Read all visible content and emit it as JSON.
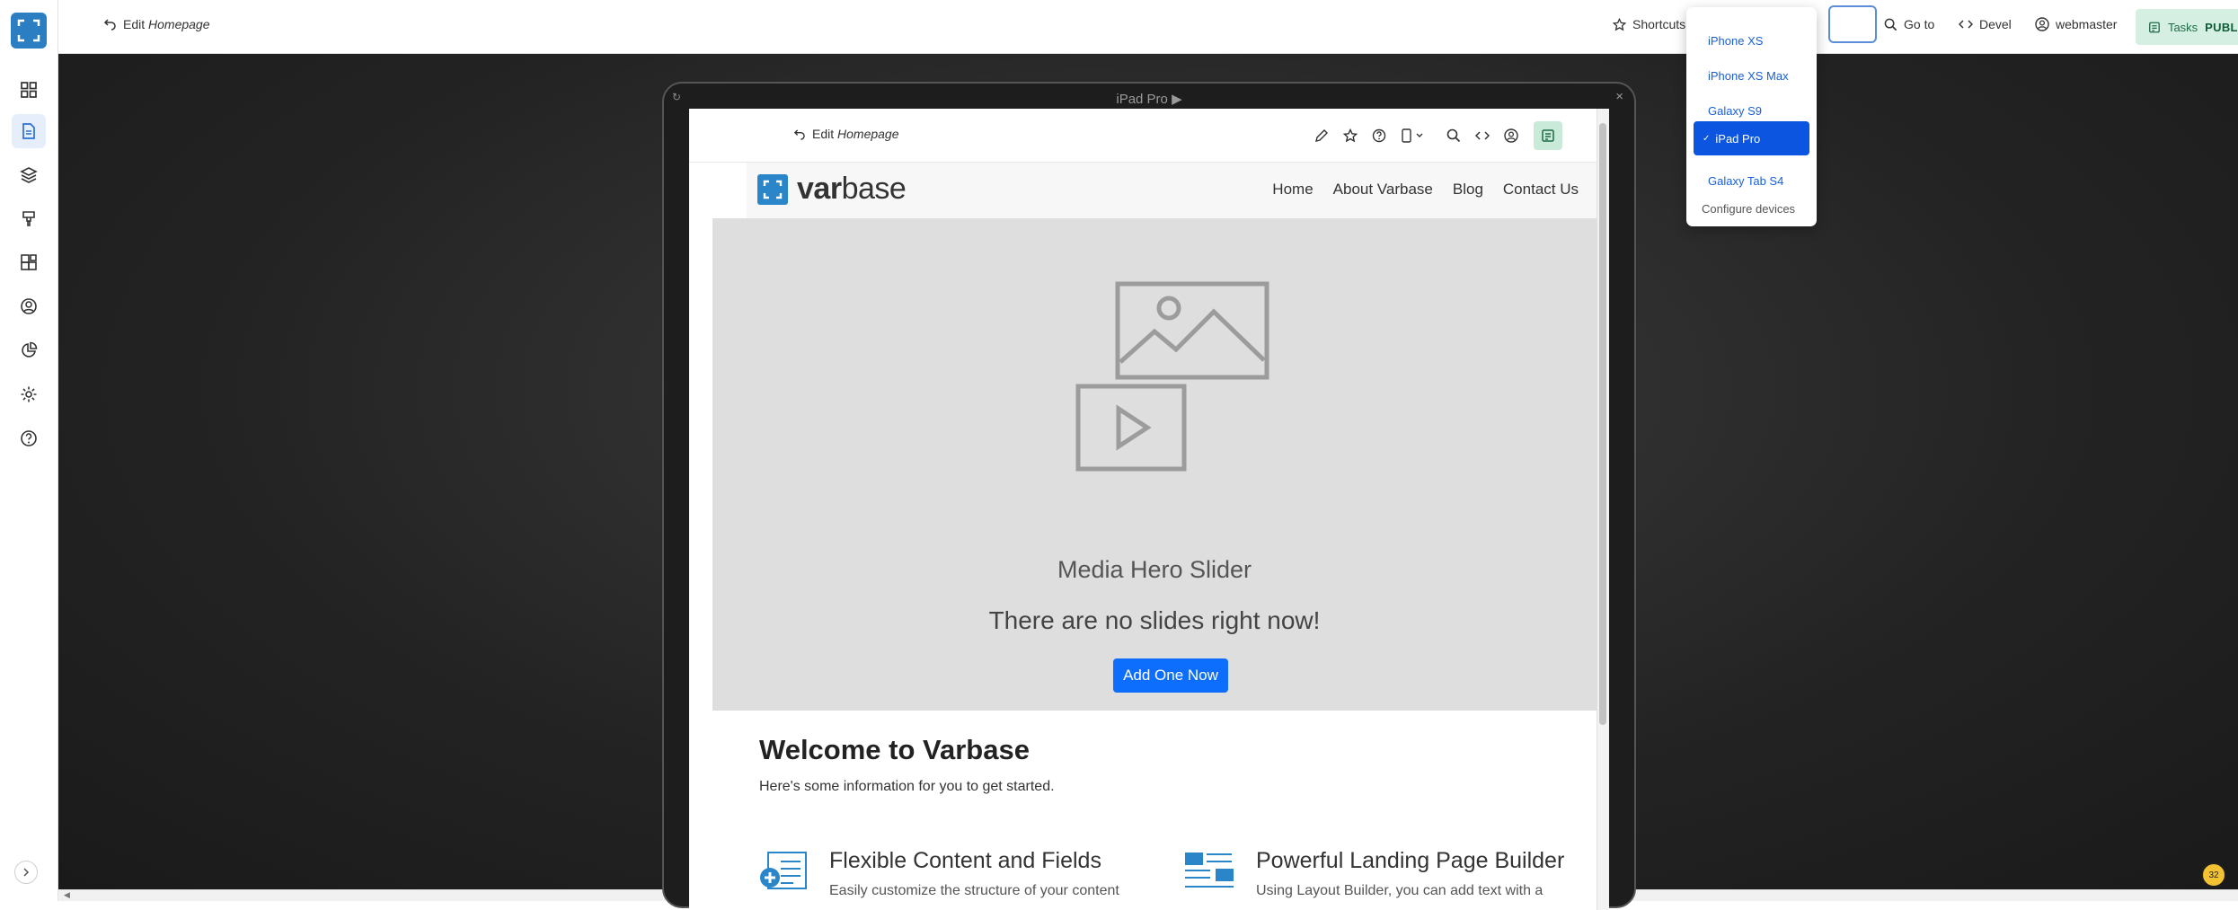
{
  "topbar": {
    "edit_prefix": "Edit",
    "edit_page": "Homepage",
    "shortcuts": "Shortcuts",
    "goto": "Go to",
    "devel": "Devel",
    "user": "webmaster",
    "tasks": "Tasks",
    "status": "PUBLISHED"
  },
  "sidebar": {
    "items": [
      {
        "icon": "dashboard-icon"
      },
      {
        "icon": "content-icon",
        "active": true
      },
      {
        "icon": "structure-icon"
      },
      {
        "icon": "appearance-icon"
      },
      {
        "icon": "extend-icon"
      },
      {
        "icon": "people-icon"
      },
      {
        "icon": "reports-icon"
      },
      {
        "icon": "configuration-icon"
      },
      {
        "icon": "help-icon"
      }
    ]
  },
  "device": {
    "title": "iPad Pro",
    "title_arrow": "▶",
    "close": "×"
  },
  "dropdown": {
    "items": [
      "iPhone XS",
      "iPhone XS Max",
      "Galaxy S9",
      "iPad Pro",
      "Galaxy Tab S4"
    ],
    "selected": "iPad Pro",
    "configure": "Configure devices"
  },
  "inner": {
    "edit_prefix": "Edit",
    "edit_page": "Homepage",
    "brand_a": "var",
    "brand_b": "base",
    "nav": [
      "Home",
      "About Varbase",
      "Blog",
      "Contact Us"
    ],
    "hero_title": "Media Hero Slider",
    "hero_sub": "There are no slides right now!",
    "hero_button": "Add One Now",
    "welcome_title": "Welcome to Varbase",
    "welcome_sub": "Here's some information for you to get started.",
    "feature1_title": "Flexible Content and Fields",
    "feature1_desc": "Easily customize the structure of your content",
    "feature2_title": "Powerful Landing Page Builder",
    "feature2_desc": "Using Layout Builder, you can add text with a"
  },
  "badge": "32",
  "colors": {
    "accent": "#2b7ec1",
    "primary_button": "#0d6efd",
    "dropdown_selected": "#0b55e0",
    "tasks_bg": "#d5efe3"
  }
}
